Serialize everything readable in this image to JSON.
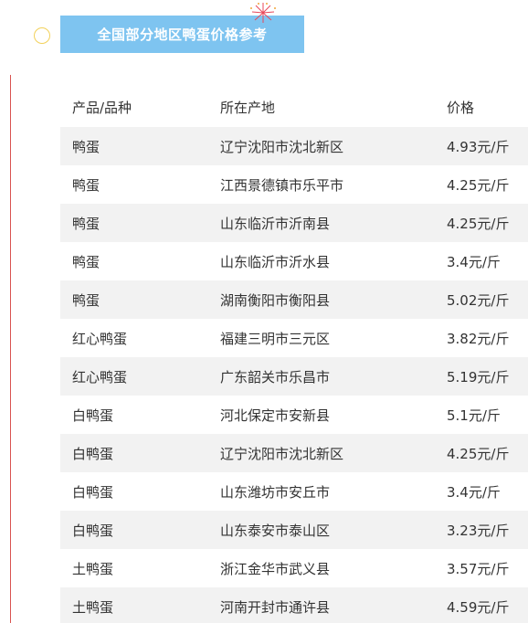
{
  "title": "全国部分地区鸭蛋价格参考",
  "table": {
    "headers": [
      "产品/品种",
      "所在产地",
      "价格"
    ],
    "rows": [
      [
        "鸭蛋",
        "辽宁沈阳市沈北新区",
        "4.93元/斤"
      ],
      [
        "鸭蛋",
        "江西景德镇市乐平市",
        "4.25元/斤"
      ],
      [
        "鸭蛋",
        "山东临沂市沂南县",
        "4.25元/斤"
      ],
      [
        "鸭蛋",
        "山东临沂市沂水县",
        "3.4元/斤"
      ],
      [
        "鸭蛋",
        "湖南衡阳市衡阳县",
        "5.02元/斤"
      ],
      [
        "红心鸭蛋",
        "福建三明市三元区",
        "3.82元/斤"
      ],
      [
        "红心鸭蛋",
        "广东韶关市乐昌市",
        "5.19元/斤"
      ],
      [
        "白鸭蛋",
        "河北保定市安新县",
        "5.1元/斤"
      ],
      [
        "白鸭蛋",
        "辽宁沈阳市沈北新区",
        "4.25元/斤"
      ],
      [
        "白鸭蛋",
        "山东潍坊市安丘市",
        "3.4元/斤"
      ],
      [
        "白鸭蛋",
        "山东泰安市泰山区",
        "3.23元/斤"
      ],
      [
        "土鸭蛋",
        "浙江金华市武义县",
        "3.57元/斤"
      ],
      [
        "土鸭蛋",
        "河南开封市通许县",
        "4.59元/斤"
      ]
    ]
  },
  "colors": {
    "title_bg": "#7ec4f0",
    "stripe": "#f2f2f2",
    "rule": "#d9534f"
  }
}
